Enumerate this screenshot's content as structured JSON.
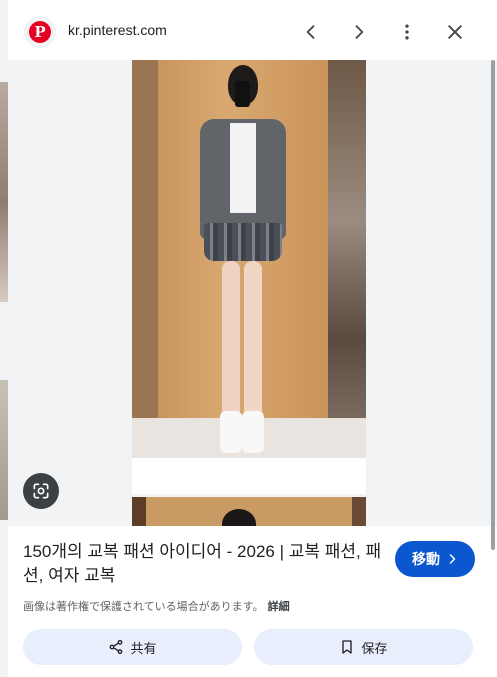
{
  "header": {
    "site_name": "Pinterest",
    "url": "kr.pinterest.com",
    "icons": [
      "pinterest-logo-icon",
      "chevron-left-icon",
      "chevron-right-icon",
      "more-vert-icon",
      "close-icon"
    ]
  },
  "image": {
    "lens_icon": "google-lens-icon"
  },
  "info": {
    "title": "150개의 교복 패션 아이디어 - 2026 | 교복 패션, 패션, 여자 교복",
    "visit_label": "移動",
    "copyright_text": "画像は著作権で保護されている場合があります。",
    "more_label": "詳細",
    "share_label": "共有",
    "save_label": "保存"
  },
  "colors": {
    "accent": "#0b57d0",
    "pinterest_red": "#e60023",
    "button_bg": "#e8eefb",
    "panel_bg": "#f1f3f4"
  }
}
